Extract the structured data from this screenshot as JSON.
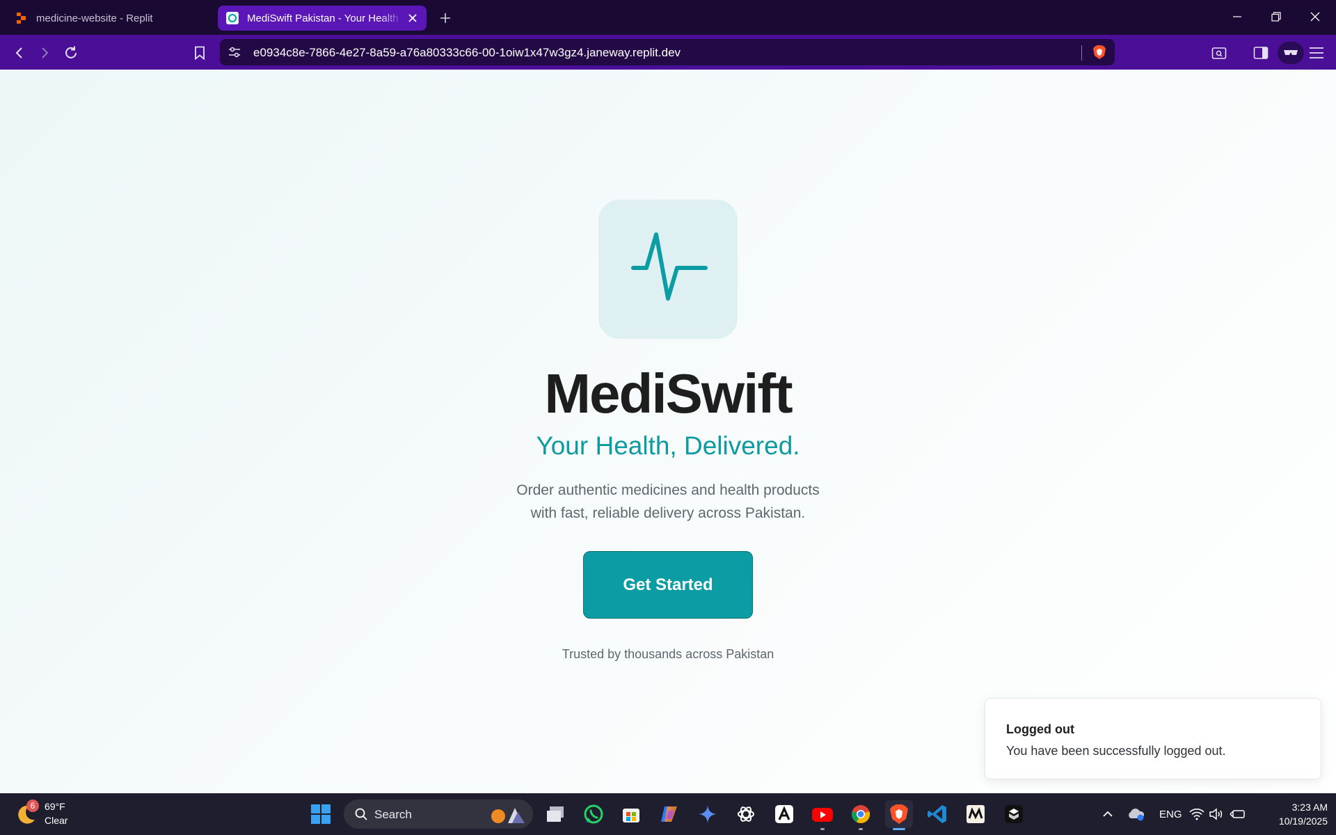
{
  "browser": {
    "tabs": [
      {
        "title": "medicine-website - Replit",
        "favicon": "replit-icon",
        "active": false
      },
      {
        "title": "MediSwift Pakistan - Your Health",
        "favicon": "mediswift-favicon",
        "active": true
      }
    ],
    "url": "e0934c8e-7866-4e27-8a59-a76a80333c66-00-1oiw1x47w3gz4.janeway.replit.dev",
    "colors": {
      "tabstrip": "#1a0933",
      "toolbar": "#4a0f96",
      "active_tab": "#5b16b8"
    }
  },
  "page": {
    "brand": "MediSwift",
    "tagline": "Your Health, Delivered.",
    "description_line1": "Order authentic medicines and health products",
    "description_line2": "with fast, reliable delivery across Pakistan.",
    "cta_label": "Get Started",
    "trusted_text": "Trusted by thousands across Pakistan",
    "logo_icon": "pulse-icon",
    "accent_color": "#0c9ca3"
  },
  "toast": {
    "title": "Logged out",
    "message": "You have been successfully logged out."
  },
  "taskbar": {
    "weather": {
      "badge": "6",
      "temp": "69°F",
      "condition": "Clear"
    },
    "search_label": "Search",
    "language": "ENG",
    "time": "3:23 AM",
    "date": "10/19/2025",
    "apps": [
      "start-icon",
      "search-icon",
      "task-view-icon",
      "whatsapp-icon",
      "store-icon",
      "copilot-icon",
      "gemini-icon",
      "chatgpt-icon",
      "text-app-icon",
      "youtube-icon",
      "chrome-icon",
      "brave-icon",
      "vscode-icon",
      "notion-like-icon",
      "box-app-icon"
    ]
  }
}
